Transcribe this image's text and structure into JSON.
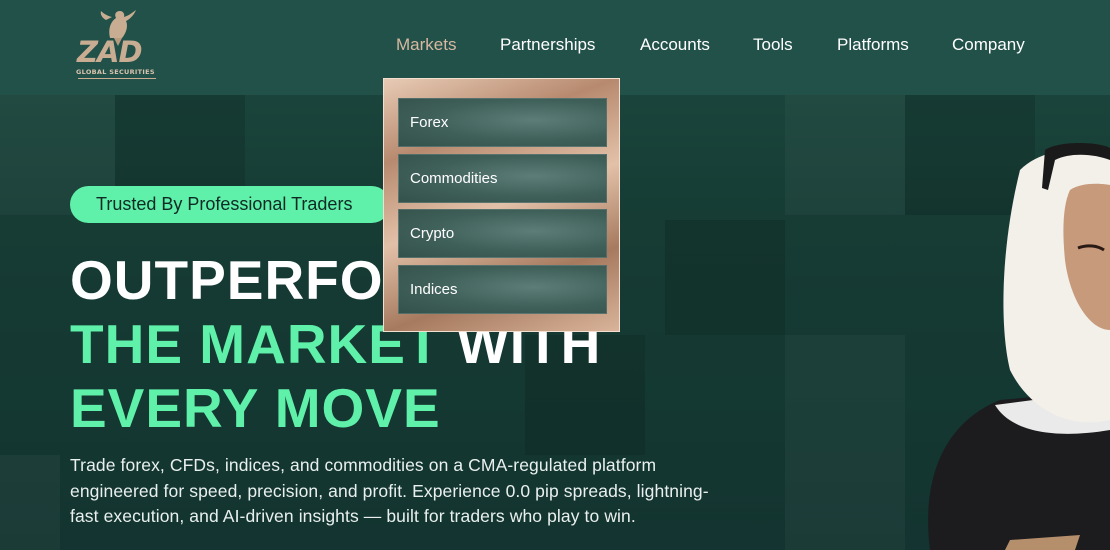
{
  "brand": {
    "name": "ZAD",
    "tagline": "GLOBAL SECURITIES"
  },
  "nav": {
    "items": [
      {
        "label": "Markets",
        "active": true
      },
      {
        "label": "Partnerships",
        "active": false
      },
      {
        "label": "Accounts",
        "active": false
      },
      {
        "label": "Tools",
        "active": false
      },
      {
        "label": "Platforms",
        "active": false
      },
      {
        "label": "Company",
        "active": false
      }
    ]
  },
  "markets_menu": {
    "items": [
      "Forex",
      "Commodities",
      "Crypto",
      "Indices"
    ]
  },
  "hero": {
    "badge": "Trusted By Professional Traders",
    "headline": {
      "line1": "OUTPERFORM",
      "line2_green": "THE MARKET",
      "line2_white": " WITH",
      "line3": "EVERY MOVE"
    },
    "description": "Trade forex, CFDs, indices, and commodities on a CMA-regulated platform engineered for speed, precision, and profit. Experience 0.0 pip spreads, lightning-fast execution, and AI-driven insights — built for traders who play to win."
  },
  "colors": {
    "accent_green": "#5ff0a9",
    "header_bg": "#22514a",
    "gold": "#c9ad92"
  }
}
